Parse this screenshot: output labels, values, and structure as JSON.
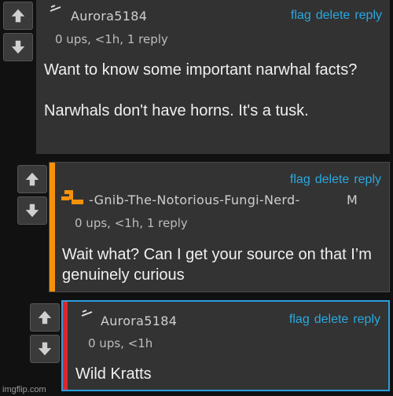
{
  "actions": {
    "flag": "flag",
    "delete": "delete",
    "reply": "reply"
  },
  "comments": [
    {
      "username": "Aurora5184",
      "meta": "0 ups, <1h, 1 reply",
      "body": "Want to know some important narwhal facts?\n\nNarwhals don't have horns. It's a tusk."
    },
    {
      "username": "-Gnib-The-Notorious-Fungi-Nerd-",
      "badge": "M",
      "meta": "0 ups, <1h, 1 reply",
      "body": "Wait what? Can I get your source on that I’m genuinely curious",
      "accent_color": "#f5920a"
    },
    {
      "username": "Aurora5184",
      "meta": "0 ups, <1h",
      "body": "Wild Kratts",
      "accent_color": "#e0252a",
      "border_color": "#2a9ee0"
    }
  ],
  "watermark": "imgflip.com"
}
